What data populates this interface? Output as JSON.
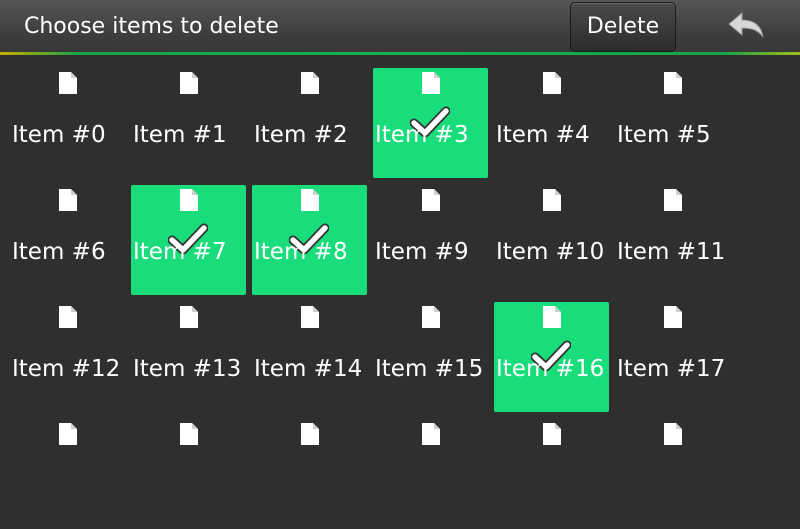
{
  "header": {
    "title": "Choose items to delete",
    "delete_label": "Delete",
    "back_icon": "back-arrow-icon"
  },
  "colors": {
    "selected": "#19dc7b",
    "background": "#2f2f2f",
    "accent_line": "#17b34f"
  },
  "items": [
    {
      "label": "Item #0",
      "selected": false
    },
    {
      "label": "Item #1",
      "selected": false
    },
    {
      "label": "Item #2",
      "selected": false
    },
    {
      "label": "Item #3",
      "selected": true
    },
    {
      "label": "Item #4",
      "selected": false
    },
    {
      "label": "Item #5",
      "selected": false
    },
    {
      "label": "Item #6",
      "selected": false
    },
    {
      "label": "Item #7",
      "selected": true
    },
    {
      "label": "Item #8",
      "selected": true
    },
    {
      "label": "Item #9",
      "selected": false
    },
    {
      "label": "Item #10",
      "selected": false
    },
    {
      "label": "Item #11",
      "selected": false
    },
    {
      "label": "Item #12",
      "selected": false
    },
    {
      "label": "Item #13",
      "selected": false
    },
    {
      "label": "Item #14",
      "selected": false
    },
    {
      "label": "Item #15",
      "selected": false
    },
    {
      "label": "Item #16",
      "selected": true
    },
    {
      "label": "Item #17",
      "selected": false
    },
    {
      "label": "",
      "selected": false
    },
    {
      "label": "",
      "selected": false
    },
    {
      "label": "",
      "selected": false
    },
    {
      "label": "",
      "selected": false
    },
    {
      "label": "",
      "selected": false
    },
    {
      "label": "",
      "selected": false
    }
  ]
}
